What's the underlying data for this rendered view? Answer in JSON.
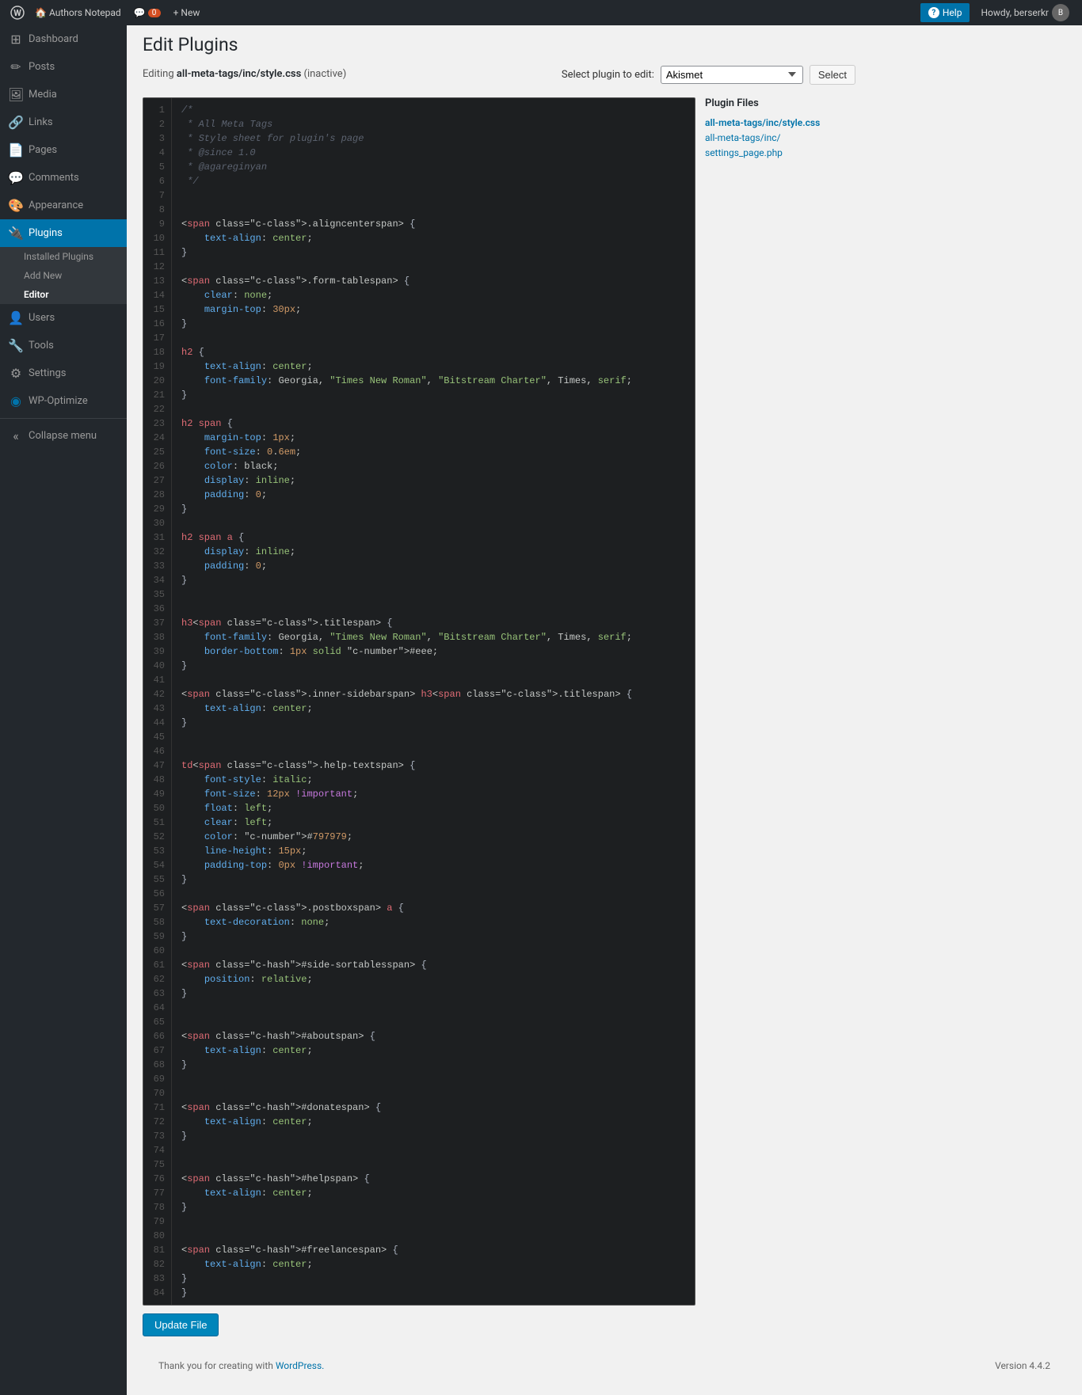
{
  "adminbar": {
    "site_name": "Authors Notepad",
    "comments_count": "0",
    "new_label": "+ New",
    "help_label": "Help",
    "howdy_text": "Howdy, berserkr"
  },
  "sidebar": {
    "menu_items": [
      {
        "id": "dashboard",
        "label": "Dashboard",
        "icon": "⊞"
      },
      {
        "id": "posts",
        "label": "Posts",
        "icon": "✏"
      },
      {
        "id": "media",
        "label": "Media",
        "icon": "🖼"
      },
      {
        "id": "links",
        "label": "Links",
        "icon": "🔗"
      },
      {
        "id": "pages",
        "label": "Pages",
        "icon": "📄"
      },
      {
        "id": "comments",
        "label": "Comments",
        "icon": "💬"
      },
      {
        "id": "appearance",
        "label": "Appearance",
        "icon": "🎨"
      },
      {
        "id": "plugins",
        "label": "Plugins",
        "icon": "🔌",
        "active": true
      }
    ],
    "plugins_submenu": [
      {
        "id": "installed-plugins",
        "label": "Installed Plugins"
      },
      {
        "id": "add-new",
        "label": "Add New"
      },
      {
        "id": "editor",
        "label": "Editor",
        "active": true
      }
    ],
    "extra_items": [
      {
        "id": "users",
        "label": "Users",
        "icon": "👤"
      },
      {
        "id": "tools",
        "label": "Tools",
        "icon": "🔧"
      },
      {
        "id": "settings",
        "label": "Settings",
        "icon": "⚙"
      },
      {
        "id": "wp-optimize",
        "label": "WP-Optimize",
        "icon": "◉"
      },
      {
        "id": "collapse-menu",
        "label": "Collapse menu",
        "icon": "«"
      }
    ]
  },
  "page": {
    "title": "Edit Plugins",
    "editing_prefix": "Editing",
    "editing_file": "all-meta-tags/inc/style.css",
    "editing_status": "(inactive)",
    "select_label": "Select plugin to edit:",
    "select_value": "Akismet",
    "select_button": "Select"
  },
  "plugin_files": {
    "heading": "Plugin Files",
    "files": [
      {
        "name": "all-meta-tags/inc/style.css",
        "active": true
      },
      {
        "name": "all-meta-tags/inc/settings_page.php",
        "active": false
      }
    ]
  },
  "code": {
    "lines": [
      "/*",
      " * All Meta Tags",
      " * Style sheet for plugin's page",
      " * @since 1.0",
      " * @agareginyan",
      " */",
      "",
      "",
      ".aligncenter {",
      "    text-align: center;",
      "}",
      "",
      ".form-table {",
      "    clear: none;",
      "    margin-top: 30px;",
      "}",
      "",
      "h2 {",
      "    text-align: center;",
      "    font-family: Georgia, \"Times New Roman\", \"Bitstream Charter\", Times, serif;",
      "}",
      "",
      "h2 span {",
      "    margin-top: 1px;",
      "    font-size: 0.6em;",
      "    color: black;",
      "    display: inline;",
      "    padding: 0;",
      "}",
      "",
      "h2 span a {",
      "    display: inline;",
      "    padding: 0;",
      "}",
      "",
      "",
      "h3.title {",
      "    font-family: Georgia, \"Times New Roman\", \"Bitstream Charter\", Times, serif;",
      "    border-bottom: 1px solid #eee;",
      "}",
      "",
      ".inner-sidebar h3.title {",
      "    text-align: center;",
      "}",
      "",
      "",
      "td.help-text {",
      "    font-style: italic;",
      "    font-size: 12px !important;",
      "    float: left;",
      "    clear: left;",
      "    color: #797979;",
      "    line-height: 15px;",
      "    padding-top: 0px !important;",
      "}",
      "",
      ".postbox a {",
      "    text-decoration: none;",
      "}",
      "",
      "#side-sortables {",
      "    position: relative;",
      "}",
      "",
      "",
      "#about {",
      "    text-align: center;",
      "}",
      "",
      "",
      "#donate {",
      "    text-align: center;",
      "}",
      "",
      "",
      "#help {",
      "    text-align: center;",
      "}",
      "",
      "",
      "#freelance {",
      "    text-align: center;",
      "}",
      "}"
    ]
  },
  "buttons": {
    "update_file": "Update File"
  },
  "footer": {
    "thank_you": "Thank you for creating with",
    "wp_link_text": "WordPress.",
    "version": "Version 4.4.2"
  }
}
